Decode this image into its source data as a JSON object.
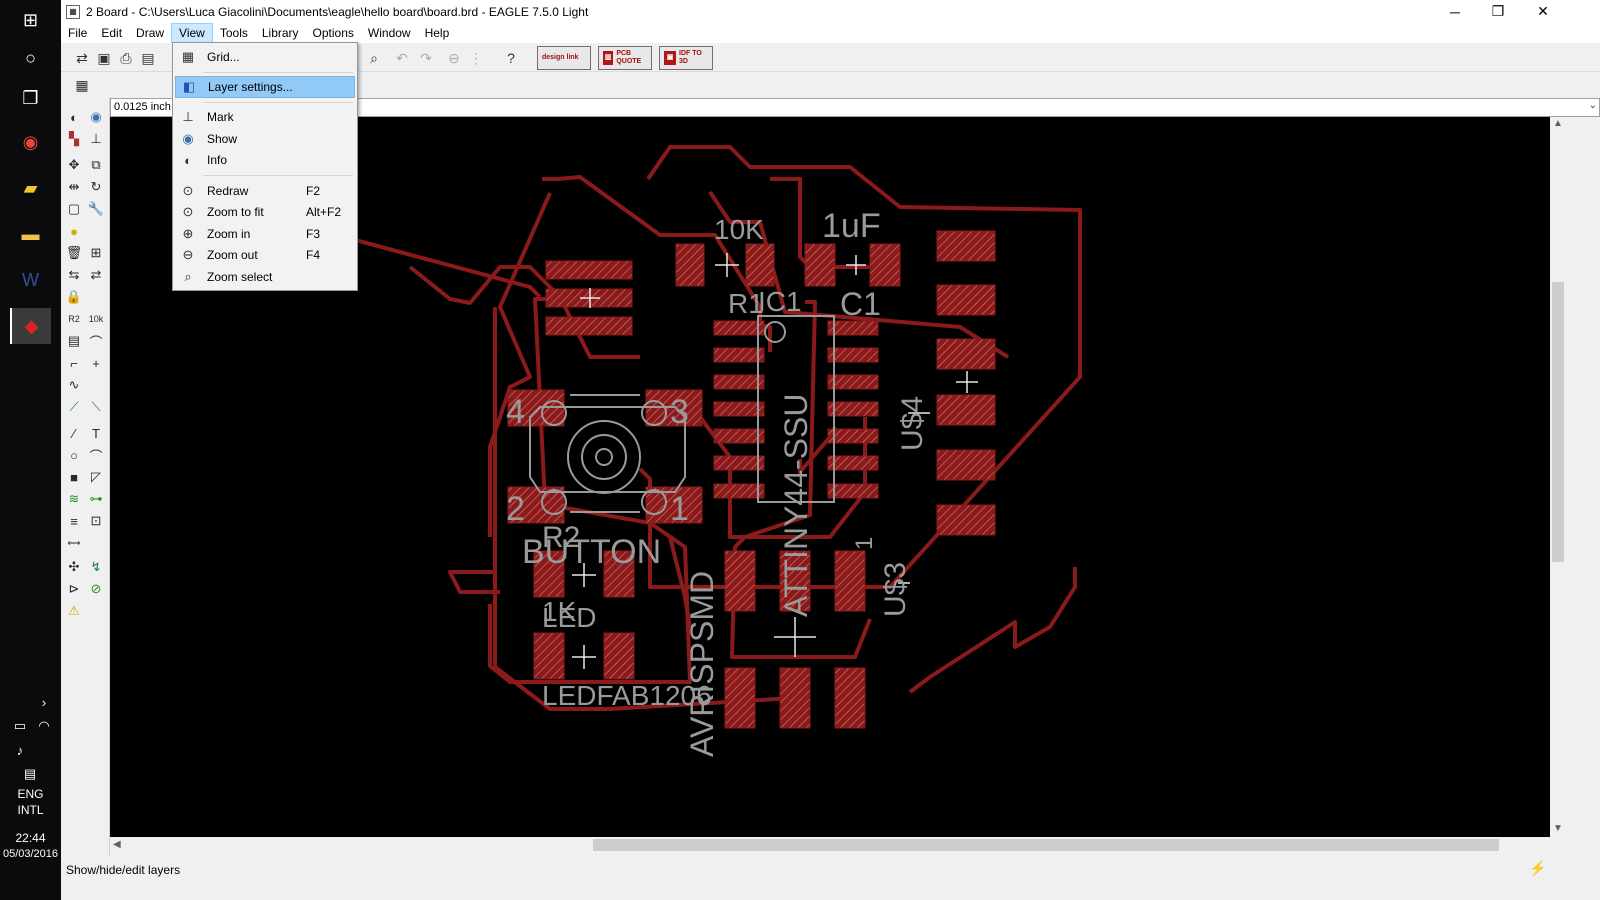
{
  "window": {
    "title": "2 Board - C:\\Users\\Luca Giacolini\\Documents\\eagle\\hello board\\board.brd - EAGLE 7.5.0 Light",
    "minimize": "─",
    "restore": "❐",
    "close": "✕"
  },
  "menu": [
    "File",
    "Edit",
    "Draw",
    "View",
    "Tools",
    "Library",
    "Options",
    "Window",
    "Help"
  ],
  "toolbar": {
    "design_link": "design link",
    "pcb_quote": "PCB QUOTE",
    "idf_3d": "IDF TO 3D"
  },
  "view_menu": {
    "grid": "Grid...",
    "layer_settings": "Layer settings...",
    "mark": "Mark",
    "show": "Show",
    "info": "Info",
    "redraw": "Redraw",
    "redraw_key": "F2",
    "zoom_fit": "Zoom to fit",
    "zoom_fit_key": "Alt+F2",
    "zoom_in": "Zoom in",
    "zoom_in_key": "F3",
    "zoom_out": "Zoom out",
    "zoom_out_key": "F4",
    "zoom_select": "Zoom select"
  },
  "command": {
    "coordinate": "0.0125 inch",
    "value": ""
  },
  "board_labels": {
    "r1_value": "10K",
    "c1_value": "1uF",
    "r1": "R1",
    "ic1": "IC1",
    "c1": "C1",
    "ic_name": "ATTINY44-SSU",
    "us4": "U$4",
    "us3": "U$3",
    "pin1": "1",
    "btn_pin4": "4",
    "btn_pin3": "3",
    "btn_pin2": "2",
    "btn_pin1": "1",
    "r2": "R2",
    "button": "BUTTON",
    "r2_value": "1K",
    "led": "LED",
    "led_value": "LEDFAB1206",
    "isp": "AVRISPSMD"
  },
  "colors": {
    "trace": "#8b1a1a",
    "pad_fill": "#8b1a1a",
    "silkscreen": "#9a9a9a",
    "canvas": "#000000"
  },
  "status": {
    "text": "Show/hide/edit layers"
  },
  "taskbar": {
    "language": "ENG",
    "layout": "INTL",
    "time": "22:44",
    "date": "05/03/2016"
  }
}
